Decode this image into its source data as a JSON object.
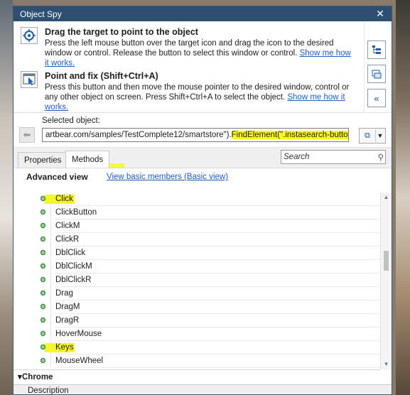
{
  "window": {
    "title": "Object Spy",
    "close": "✕"
  },
  "modes": [
    {
      "title": "Drag the target to point to the object",
      "desc": "Press the left mouse button over the target icon and drag the icon to the desired window or control. Release the button to select this window or control.",
      "link": "Show me how it works."
    },
    {
      "title": "Point and fix (Shift+Ctrl+A)",
      "desc": "Press this button and then move the mouse pointer to the desired window, control or any other object on screen. Press Shift+Ctrl+A to select the object.",
      "link": "Show me how it works."
    }
  ],
  "selected": {
    "label": "Selected object:",
    "value_prefix": "artbear.com/samples/TestComplete12/smartstore\").",
    "value_highlight": "FindElement(\".instasearch-button\")"
  },
  "tabs": [
    {
      "label": "Properties"
    },
    {
      "label": "Methods"
    }
  ],
  "search": {
    "placeholder": "Search"
  },
  "list": {
    "view_title": "Advanced view",
    "view_link": "View basic members (Basic view)",
    "methods": [
      "Click",
      "ClickButton",
      "ClickM",
      "ClickR",
      "DblClick",
      "DblClickM",
      "DblClickR",
      "Drag",
      "DragM",
      "DragR",
      "HoverMouse",
      "Keys",
      "MouseWheel"
    ],
    "highlighted": [
      "Click",
      "Keys"
    ],
    "group": "Chrome"
  },
  "bottom": {
    "description": "Description"
  },
  "icons": {
    "crosshair": "crosshair-icon",
    "pointer": "point-and-fix-icon",
    "tree": "object-tree-icon",
    "browser": "object-browser-icon",
    "collapse": "collapse-icon",
    "back": "back-arrow-icon",
    "copy": "copy-icon",
    "method": "method-icon",
    "search": "search-icon"
  },
  "colors": {
    "title_bar": "#2d4f72",
    "highlight": "#fbfb1a",
    "link": "#1f5fbf"
  }
}
